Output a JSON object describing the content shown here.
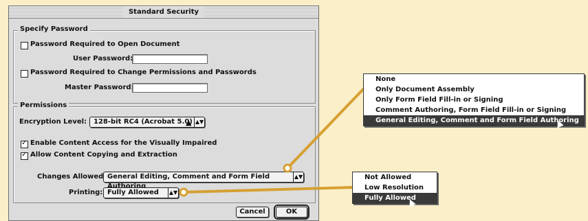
{
  "dialog": {
    "title": "Standard Security",
    "specify_password": {
      "legend": "Specify Password",
      "open_doc_label": "Password Required to Open Document",
      "open_doc_checked": false,
      "user_password_label": "User Password:",
      "user_password_value": "",
      "change_perm_label": "Password Required to Change Permissions and Passwords",
      "change_perm_checked": false,
      "master_password_label": "Master Password:",
      "master_password_value": ""
    },
    "permissions": {
      "legend": "Permissions",
      "encryption_label": "Encryption Level:",
      "encryption_value": "128-bit RC4 (Acrobat 5.0)",
      "content_access_label": "Enable Content Access for the Visually Impaired",
      "content_access_checked": true,
      "copying_label": "Allow Content Copying and Extraction",
      "copying_checked": true,
      "changes_label": "Changes Allowed:",
      "changes_value": "General Editing, Comment and Form Field Authoring",
      "printing_label": "Printing:",
      "printing_value": "Fully Allowed"
    },
    "buttons": {
      "cancel": "Cancel",
      "ok": "OK"
    }
  },
  "changes_menu": {
    "items": [
      "None",
      "Only Document Assembly",
      "Only Form Field Fill-in or Signing",
      "Comment Authoring, Form Field Fill-in or Signing",
      "General Editing, Comment and Form Field Authoring"
    ],
    "selected_index": 4
  },
  "printing_menu": {
    "items": [
      "Not Allowed",
      "Low Resolution",
      "Fully Allowed"
    ],
    "selected_index": 2
  },
  "colors": {
    "background": "#fbefc9",
    "leader_line": "#d6a032",
    "dialog": "#dcdcdc",
    "menu_highlight": "#3a3a3a"
  }
}
